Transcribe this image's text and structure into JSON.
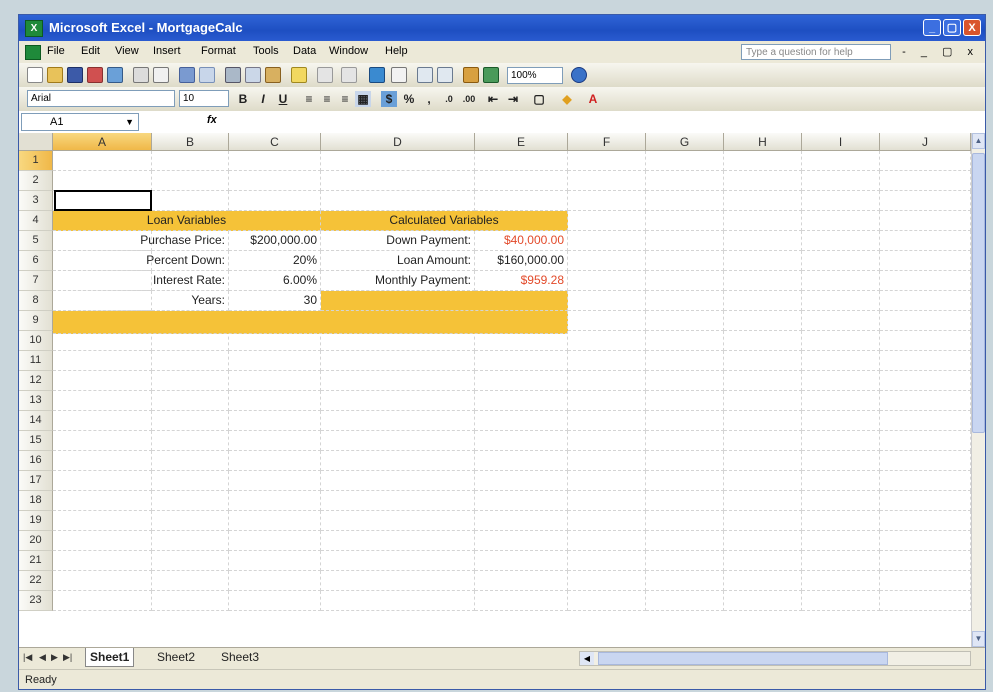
{
  "window": {
    "title": "Microsoft Excel - MortgageCalc",
    "buttons": [
      "_",
      "▢",
      "X"
    ]
  },
  "menu": {
    "items": [
      "File",
      "Edit",
      "View",
      "Insert",
      "Format",
      "Tools",
      "Data",
      "Window",
      "Help"
    ],
    "ask_placeholder": "Type a question for help",
    "right_controls": "- _ ▢ x"
  },
  "formatting": {
    "font": "Arial",
    "size": "10",
    "zoom": "100%"
  },
  "formula_bar": {
    "name_box": "A1",
    "fx": "fx",
    "value": ""
  },
  "columns": [
    "A",
    "B",
    "C",
    "D",
    "E",
    "F",
    "G",
    "H",
    "I",
    "J"
  ],
  "rows": [
    "1",
    "2",
    "3",
    "4",
    "5",
    "6",
    "7",
    "8",
    "9",
    "10",
    "11",
    "12",
    "13",
    "14",
    "15",
    "16",
    "17",
    "18",
    "19",
    "20",
    "21",
    "22",
    "23"
  ],
  "sheet": {
    "loan_header": "Loan Variables",
    "calc_header": "Calculated Variables",
    "purchase_price_label": "Purchase Price:",
    "purchase_price": "$200,000.00",
    "percent_down_label": "Percent Down:",
    "percent_down": "20%",
    "interest_rate_label": "Interest Rate:",
    "interest_rate": "6.00%",
    "years_label": "Years:",
    "years": "30",
    "down_payment_label": "Down Payment:",
    "down_payment": "$40,000.00",
    "loan_amount_label": "Loan Amount:",
    "loan_amount": "$160,000.00",
    "monthly_payment_label": "Monthly Payment:",
    "monthly_payment": "$959.28"
  },
  "tabs": [
    "Sheet1",
    "Sheet2",
    "Sheet3"
  ],
  "status": "Ready",
  "colors": {
    "highlight": "#f5c238",
    "red_value": "#e24a2a",
    "title_blue": "#2f64d6"
  }
}
